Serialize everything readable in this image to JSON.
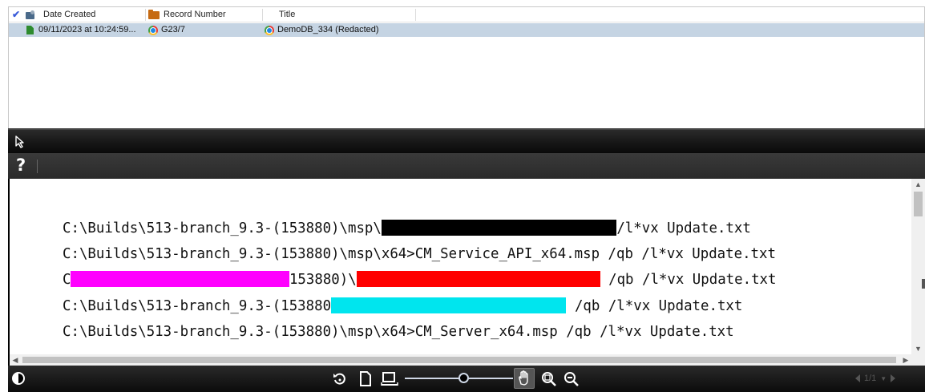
{
  "list": {
    "columns": {
      "date_created": "Date Created",
      "record_number": "Record Number",
      "title": "Title"
    },
    "rows": [
      {
        "date_created": "09/11/2023 at 10:24:59...",
        "record_number": "G23/7",
        "title": "DemoDB_334 (Redacted)"
      }
    ],
    "selected_row_color": "#c5d4e3"
  },
  "viewer": {
    "lines": [
      {
        "segments": [
          {
            "type": "text",
            "text": "C:\\Builds\\513-branch_9.3-(153880)\\msp\\"
          },
          {
            "type": "redact",
            "color": "#000000",
            "chars": 28
          },
          {
            "type": "text",
            "text": "/l*vx Update.txt"
          }
        ]
      },
      {
        "segments": [
          {
            "type": "text",
            "text": "C:\\Builds\\513-branch_9.3-(153880)\\msp\\x64>CM_Service_API_x64.msp /qb /l*vx Update.txt"
          }
        ]
      },
      {
        "segments": [
          {
            "type": "text",
            "text": "C"
          },
          {
            "type": "redact",
            "color": "#ff00ff",
            "chars": 26
          },
          {
            "type": "text",
            "text": "153880)\\"
          },
          {
            "type": "redact",
            "color": "#ff0000",
            "chars": 29
          },
          {
            "type": "text",
            "text": " /qb /l*vx Update.txt"
          }
        ]
      },
      {
        "segments": [
          {
            "type": "text",
            "text": "C:\\Builds\\513-branch_9.3-(153880"
          },
          {
            "type": "redact",
            "color": "#00e5ee",
            "chars": 28
          },
          {
            "type": "text",
            "text": " /qb /l*vx Update.txt"
          }
        ]
      },
      {
        "segments": [
          {
            "type": "text",
            "text": "C:\\Builds\\513-branch_9.3-(153880)\\msp\\x64>CM_Server_x64.msp /qb /l*vx Update.txt"
          }
        ]
      }
    ],
    "pager": "1/1",
    "icons": {
      "pointer": "pointer-icon",
      "help": "?",
      "contrast": "contrast-icon",
      "rotate": "rotate-icon",
      "page": "page-icon",
      "fit_width": "fit-width-icon",
      "hand": "hand-icon",
      "zoom_area": "zoom-area-icon",
      "zoom_out": "zoom-out-icon"
    },
    "zoom_level": 0.5
  }
}
